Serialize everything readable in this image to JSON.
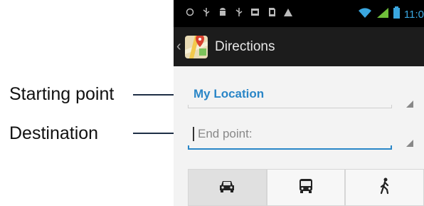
{
  "annotations": {
    "starting_point": "Starting point",
    "destination": "Destination"
  },
  "status_bar": {
    "time": "11:0",
    "left_icons": [
      "circle-icon",
      "usb-icon",
      "android-icon",
      "usb-icon",
      "image-icon",
      "sd-card-icon",
      "warning-icon"
    ],
    "right_icons": [
      "wifi-icon",
      "signal-icon",
      "battery-icon"
    ],
    "accent_color": "#3aa7e0"
  },
  "action_bar": {
    "title": "Directions",
    "app_icon": "maps-icon"
  },
  "directions": {
    "start_value": "My Location",
    "end_placeholder": "End point:",
    "accent_color": "#2a86c7"
  },
  "travel_modes": [
    {
      "icon": "car-icon",
      "selected": true
    },
    {
      "icon": "bus-icon",
      "selected": false
    },
    {
      "icon": "walk-icon",
      "selected": false
    }
  ]
}
